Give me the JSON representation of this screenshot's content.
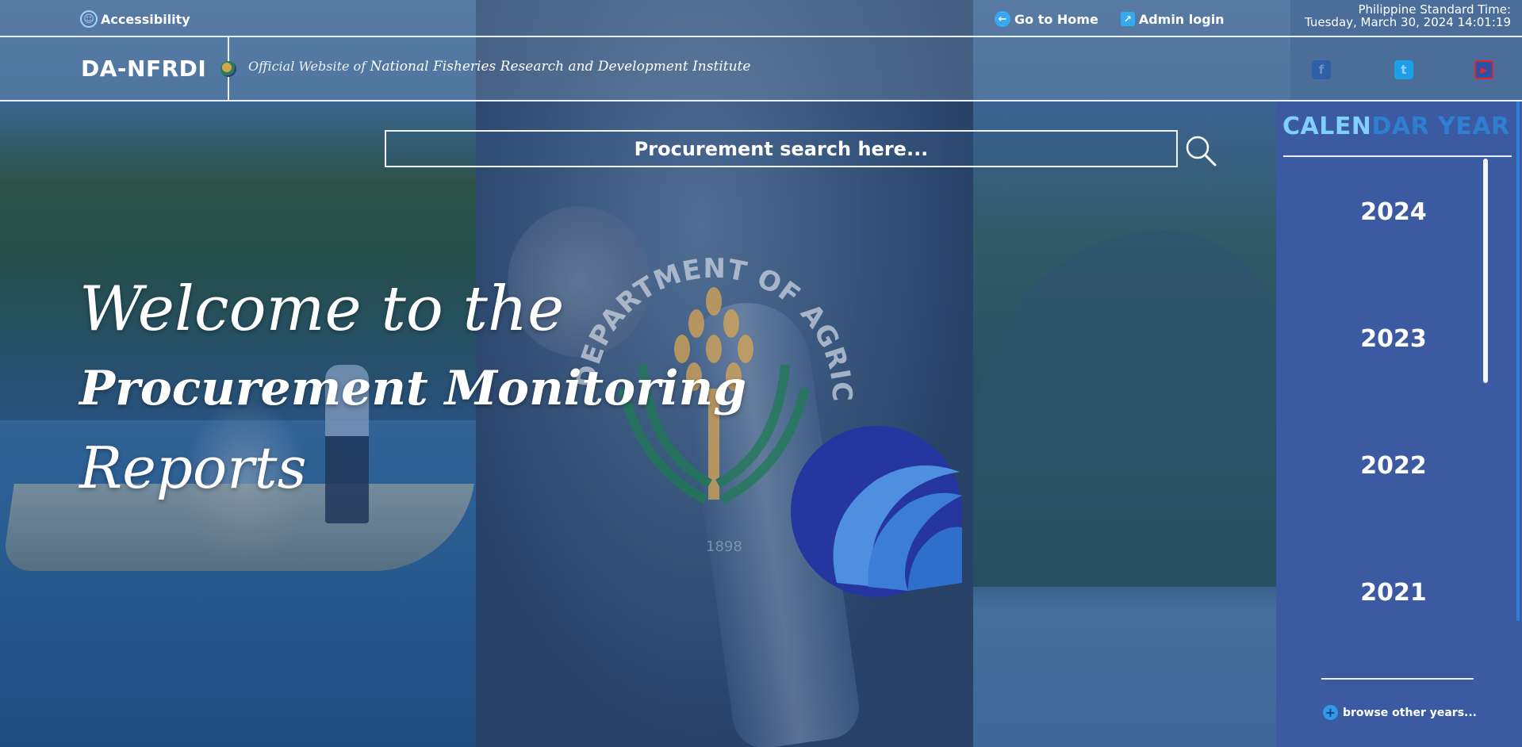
{
  "topbar": {
    "accessibility_label": "Accessibility",
    "go_home_label": "Go to Home",
    "admin_login_label": "Admin login",
    "time_label": "Philippine Standard Time:",
    "time_value": "Tuesday, March 30, 2024 14:01:19"
  },
  "header": {
    "brand": "DA-NFRDI",
    "tagline_prefix": "Official Website of",
    "tagline_name": "National Fisheries Research and Development Institute"
  },
  "search": {
    "placeholder": "Procurement search here..."
  },
  "hero": {
    "line1": "Welcome to the",
    "line2": "Procurement Monitoring",
    "line3": "Reports",
    "logo_text": "DEPARTMENT OF AGRICULTURE",
    "logo_year": "1898"
  },
  "sidebar": {
    "title": "CALENDAR YEAR",
    "years": [
      "2024",
      "2023",
      "2022",
      "2021"
    ],
    "browse_label": "browse other years..."
  },
  "icons": {
    "accessibility": "accessibility-icon",
    "home": "arrow-left-circle-icon",
    "admin": "external-link-icon",
    "search": "search-icon",
    "facebook": "facebook-icon",
    "twitter": "twitter-icon",
    "youtube": "youtube-icon",
    "browse": "plus-circle-icon"
  },
  "colors": {
    "sidebar_bg": "#3b5aa2",
    "accent": "#36a9f0",
    "youtube_red": "#e8242c"
  }
}
